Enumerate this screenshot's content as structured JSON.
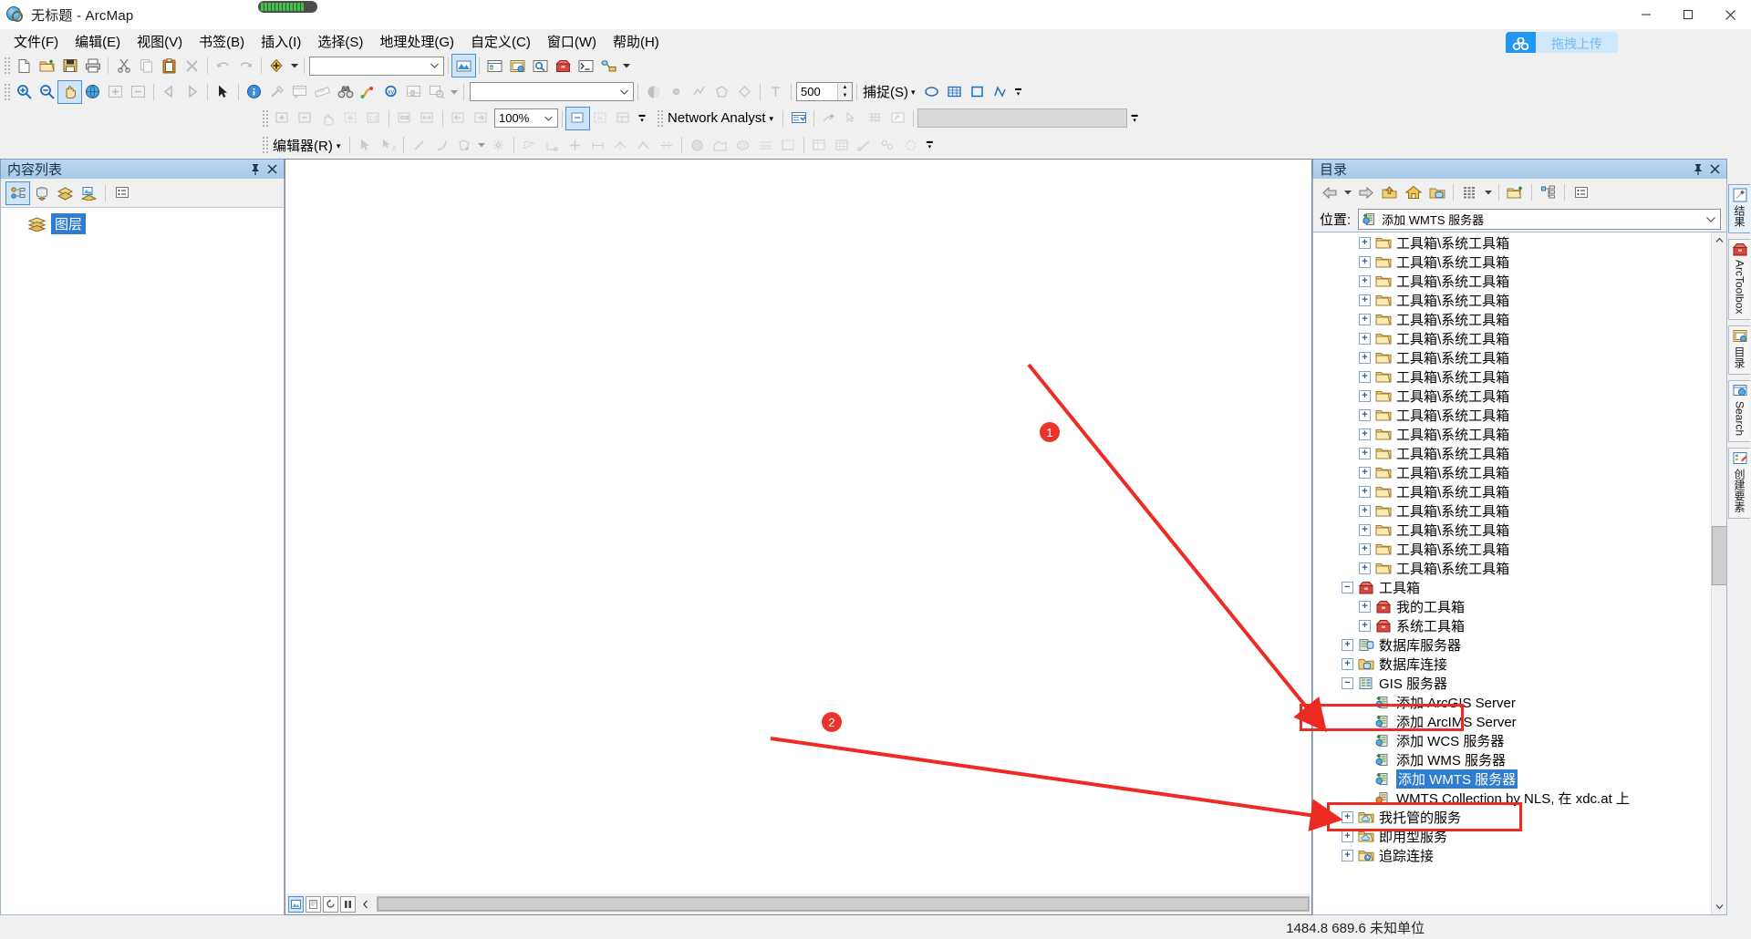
{
  "window": {
    "title": "无标题 - ArcMap",
    "app_icon": "arcmap-globe-icon",
    "minimize": "minimize-icon",
    "maximize": "maximize-icon",
    "close": "close-icon"
  },
  "menubar": {
    "items": [
      {
        "label": "文件(F)",
        "name": "menu-file"
      },
      {
        "label": "编辑(E)",
        "name": "menu-edit"
      },
      {
        "label": "视图(V)",
        "name": "menu-view"
      },
      {
        "label": "书签(B)",
        "name": "menu-bookmarks"
      },
      {
        "label": "插入(I)",
        "name": "menu-insert"
      },
      {
        "label": "选择(S)",
        "name": "menu-selection"
      },
      {
        "label": "地理处理(G)",
        "name": "menu-geoprocessing"
      },
      {
        "label": "自定义(C)",
        "name": "menu-customize"
      },
      {
        "label": "窗口(W)",
        "name": "menu-window"
      },
      {
        "label": "帮助(H)",
        "name": "menu-help"
      }
    ]
  },
  "upload_button": {
    "label": "拖拽上传",
    "accent": "#2196f3",
    "label_bg": "#cfe8fb",
    "label_color": "#74b9f0"
  },
  "standard_toolbar": {
    "buttons": [
      "new-document-icon",
      "open-folder-icon",
      "save-icon",
      "print-icon",
      "cut-icon",
      "copy-icon",
      "paste-icon",
      "delete-icon",
      "undo-icon",
      "redo-icon",
      "add-data-icon"
    ],
    "scale_combo_value": "",
    "extra_buttons": [
      "edit-toolbar-icon",
      "table-of-contents-icon",
      "catalog-icon",
      "search-icon",
      "arctoolbox-icon",
      "python-window-icon",
      "model-builder-icon"
    ]
  },
  "tools_toolbar": {
    "zoom_in": "zoom-in-icon",
    "zoom_out": "zoom-out-icon",
    "pan": "pan-hand-icon",
    "full_extent": "globe-full-extent-icon",
    "fixed_zoom_in": "fixed-zoom-in-icon",
    "fixed_zoom_out": "fixed-zoom-out-icon",
    "select_arrow": "select-arrow-icon",
    "identify": "identify-icon",
    "hyperlink": "hyperlink-icon",
    "html_popup": "html-popup-icon",
    "measure": "measure-icon",
    "find": "find-binoculars-icon",
    "find_route": "find-route-icon",
    "go_to_xy": "go-to-xy-icon",
    "time_slider": "time-slider-icon",
    "create_viewer": "create-viewer-icon",
    "search_value": "",
    "transparency_value": "500",
    "snapping_label": "捕捉(S)",
    "snapping_buttons": [
      "snap-point-icon",
      "snap-edge-icon",
      "snap-vertex-icon",
      "snap-end-icon"
    ]
  },
  "layout_toolbar": {
    "zoom_value": "100%",
    "buttons": [
      "layout-zoom-in-icon",
      "layout-zoom-out-icon",
      "layout-pan-icon",
      "layout-full-extent-icon",
      "layout-1to1-icon",
      "layout-zoom-whole-page-icon",
      "layout-zoom-page-width-icon",
      "layout-back-icon",
      "layout-forward-icon",
      "toggle-draft-mode-icon",
      "focus-data-frame-icon",
      "change-layout-icon"
    ],
    "network_analyst_label": "Network Analyst",
    "network_buttons": [
      "network-analyst-window-icon",
      "create-location-icon",
      "select-network-location-icon",
      "build-network-icon",
      "directions-window-icon"
    ],
    "network_combo_value": ""
  },
  "editor_toolbar": {
    "label": "编辑器(R)",
    "buttons": [
      "edit-tool-icon",
      "edit-annotation-icon",
      "straight-segment-icon",
      "endpoint-arc-icon",
      "trace-icon",
      "sketch-properties-icon",
      "rectangle-icon",
      "mid-point-icon",
      "distance-distance-icon",
      "direction-distance-icon",
      "intersection-icon",
      "arc-icon",
      "tangent-icon",
      "split-icon",
      "merge-icon",
      "buffer-icon",
      "copy-parallel-icon",
      "clip-icon",
      "attributes-icon",
      "editor-table-icon",
      "sketch-icon",
      "topology-icon",
      "more-icon"
    ]
  },
  "toc_panel": {
    "title": "内容列表",
    "pin": "pin-icon",
    "close": "close-icon",
    "tool_buttons": [
      "list-by-drawing-order-icon",
      "list-by-source-icon",
      "list-by-visibility-icon",
      "list-by-selection-icon",
      "toc-options-icon"
    ],
    "layers_node": {
      "label": "图层",
      "icon": "layers-icon",
      "selected": true
    }
  },
  "map_status": {
    "buttons": [
      "data-view-icon",
      "layout-view-icon",
      "refresh-icon",
      "pause-drawing-icon",
      "scroll-left-icon"
    ]
  },
  "catalog_panel": {
    "title": "目录",
    "pin": "pin-icon",
    "close": "close-icon",
    "toolbar": [
      "back-arrow-icon",
      "back-dropdown-caret-icon",
      "forward-arrow-icon",
      "up-one-level-icon",
      "home-icon",
      "default-geodatabase-icon",
      "contents-view-icon",
      "contents-view-caret-icon",
      "connect-to-folder-icon",
      "toggle-tree-view-icon",
      "catalog-options-icon"
    ],
    "location_label": "位置:",
    "location_value": "添加 WMTS 服务器",
    "location_icon": "add-wmts-server-icon",
    "tree": [
      {
        "label": "工具箱\\系统工具箱",
        "icon": "folder-icon",
        "indent": 2,
        "expandable": true
      },
      {
        "label": "工具箱\\系统工具箱",
        "icon": "folder-icon",
        "indent": 2,
        "expandable": true
      },
      {
        "label": "工具箱\\系统工具箱",
        "icon": "folder-icon",
        "indent": 2,
        "expandable": true
      },
      {
        "label": "工具箱\\系统工具箱",
        "icon": "folder-icon",
        "indent": 2,
        "expandable": true
      },
      {
        "label": "工具箱\\系统工具箱",
        "icon": "folder-icon",
        "indent": 2,
        "expandable": true
      },
      {
        "label": "工具箱\\系统工具箱",
        "icon": "folder-icon",
        "indent": 2,
        "expandable": true
      },
      {
        "label": "工具箱\\系统工具箱",
        "icon": "folder-icon",
        "indent": 2,
        "expandable": true
      },
      {
        "label": "工具箱\\系统工具箱",
        "icon": "folder-icon",
        "indent": 2,
        "expandable": true
      },
      {
        "label": "工具箱\\系统工具箱",
        "icon": "folder-icon",
        "indent": 2,
        "expandable": true
      },
      {
        "label": "工具箱\\系统工具箱",
        "icon": "folder-icon",
        "indent": 2,
        "expandable": true
      },
      {
        "label": "工具箱\\系统工具箱",
        "icon": "folder-icon",
        "indent": 2,
        "expandable": true
      },
      {
        "label": "工具箱\\系统工具箱",
        "icon": "folder-icon",
        "indent": 2,
        "expandable": true
      },
      {
        "label": "工具箱\\系统工具箱",
        "icon": "folder-icon",
        "indent": 2,
        "expandable": true
      },
      {
        "label": "工具箱\\系统工具箱",
        "icon": "folder-icon",
        "indent": 2,
        "expandable": true
      },
      {
        "label": "工具箱\\系统工具箱",
        "icon": "folder-icon",
        "indent": 2,
        "expandable": true
      },
      {
        "label": "工具箱\\系统工具箱",
        "icon": "folder-icon",
        "indent": 2,
        "expandable": true
      },
      {
        "label": "工具箱\\系统工具箱",
        "icon": "folder-icon",
        "indent": 2,
        "expandable": true
      },
      {
        "label": "工具箱\\系统工具箱",
        "icon": "folder-icon",
        "indent": 2,
        "expandable": true
      },
      {
        "label": "工具箱",
        "icon": "toolbox-icon",
        "indent": 1,
        "expandable": true,
        "expanded": true
      },
      {
        "label": "我的工具箱",
        "icon": "toolbox-icon",
        "indent": 2,
        "expandable": true
      },
      {
        "label": "系统工具箱",
        "icon": "toolbox-icon",
        "indent": 2,
        "expandable": true
      },
      {
        "label": "数据库服务器",
        "icon": "database-server-icon",
        "indent": 1,
        "expandable": true
      },
      {
        "label": "数据库连接",
        "icon": "database-connection-icon",
        "indent": 1,
        "expandable": true
      },
      {
        "label": "GIS 服务器",
        "icon": "gis-server-icon",
        "indent": 1,
        "expandable": true,
        "expanded": true,
        "highlighted": true
      },
      {
        "label": "添加 ArcGIS Server",
        "icon": "add-server-icon",
        "indent": 2
      },
      {
        "label": "添加 ArcIMS Server",
        "icon": "add-server-icon",
        "indent": 2
      },
      {
        "label": "添加 WCS 服务器",
        "icon": "add-server-icon",
        "indent": 2
      },
      {
        "label": "添加 WMS 服务器",
        "icon": "add-server-icon",
        "indent": 2
      },
      {
        "label": "添加 WMTS 服务器",
        "icon": "add-server-icon",
        "indent": 2,
        "selected": true
      },
      {
        "label": "WMTS Collection by NLS, 在 xdc.at 上",
        "icon": "wmts-connection-icon",
        "indent": 2
      },
      {
        "label": "我托管的服务",
        "icon": "cloud-folder-icon",
        "indent": 1,
        "expandable": true
      },
      {
        "label": "即用型服务",
        "icon": "cloud-folder-icon",
        "indent": 1,
        "expandable": true
      },
      {
        "label": "追踪连接",
        "icon": "tracking-connection-icon",
        "indent": 1,
        "expandable": true
      }
    ]
  },
  "side_tabs": [
    {
      "label": "结果",
      "icon": "results-hammer-icon",
      "name": "side-tab-results",
      "active": true
    },
    {
      "label": "ArcToolbox",
      "icon": "arctoolbox-icon",
      "name": "side-tab-arctoolbox"
    },
    {
      "label": "目录",
      "icon": "catalog-icon",
      "name": "side-tab-catalog"
    },
    {
      "label": "Search",
      "icon": "search-window-icon",
      "name": "side-tab-search"
    },
    {
      "label": "创建要素",
      "icon": "create-features-icon",
      "name": "side-tab-create-features"
    }
  ],
  "statusbar": {
    "coordinates": "1484.8  689.6 未知单位"
  },
  "annotations": {
    "callout_1": "1",
    "callout_2": "2",
    "accent": "#ee2b22"
  }
}
